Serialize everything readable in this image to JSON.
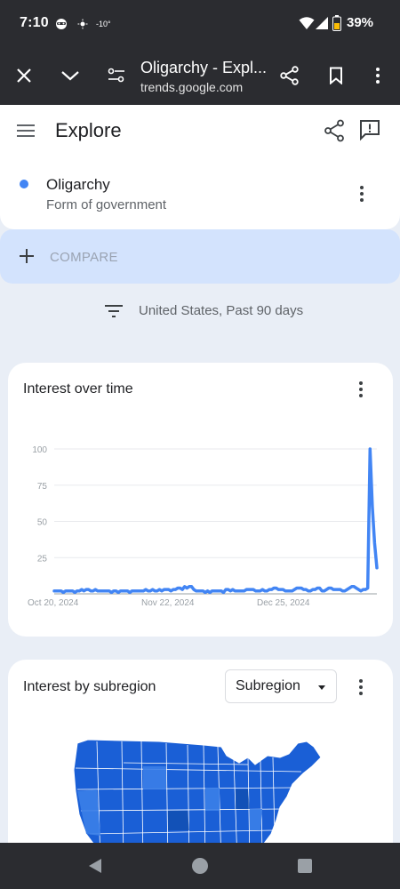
{
  "status_bar": {
    "time": "7:10",
    "temperature": "-10°",
    "battery": "39%"
  },
  "browser": {
    "page_title": "Oligarchy - Expl...",
    "url": "trends.google.com"
  },
  "app_header": {
    "title": "Explore"
  },
  "search_term": {
    "name": "Oligarchy",
    "type": "Form of government",
    "color": "#4285f4"
  },
  "compare": {
    "label": "COMPARE"
  },
  "filter": {
    "text": "United States, Past 90 days"
  },
  "interest_over_time": {
    "heading": "Interest over time"
  },
  "interest_by_subregion": {
    "heading": "Interest by subregion",
    "dropdown_value": "Subregion"
  },
  "chart_data": {
    "type": "line",
    "title": "Interest over time",
    "xlabel": "",
    "ylabel": "",
    "ylim": [
      0,
      100
    ],
    "y_ticks": [
      25,
      50,
      75,
      100
    ],
    "x_tick_labels": [
      "Oct 20, 2024",
      "Nov 22, 2024",
      "Dec 25, 2024"
    ],
    "grid": true,
    "series": [
      {
        "color": "#4285f4",
        "values": [
          2,
          2,
          2,
          2,
          1,
          2,
          2,
          2,
          2,
          1,
          2,
          2,
          3,
          2,
          3,
          3,
          2,
          2,
          3,
          2,
          2,
          2,
          2,
          2,
          2,
          1,
          2,
          2,
          1,
          2,
          2,
          2,
          2,
          1,
          2,
          2,
          2,
          2,
          2,
          2,
          3,
          2,
          2,
          3,
          2,
          2,
          3,
          2,
          3,
          3,
          3,
          2,
          3,
          3,
          4,
          4,
          3,
          5,
          4,
          5,
          5,
          3,
          2,
          2,
          2,
          2,
          1,
          2,
          1,
          2,
          2,
          2,
          2,
          2,
          1,
          3,
          3,
          2,
          3,
          2,
          2,
          2,
          2,
          2,
          3,
          3,
          3,
          3,
          2,
          2,
          2,
          3,
          2,
          2,
          3,
          3,
          4,
          4,
          3,
          3,
          3,
          2,
          2,
          2,
          2,
          3,
          4,
          4,
          4,
          3,
          3,
          2,
          2,
          3,
          3,
          4,
          4,
          2,
          2,
          3,
          4,
          4,
          3,
          3,
          3,
          3,
          2,
          2,
          3,
          4,
          5,
          5,
          4,
          3,
          2,
          3,
          3,
          4,
          100,
          60,
          35,
          18
        ]
      }
    ]
  }
}
